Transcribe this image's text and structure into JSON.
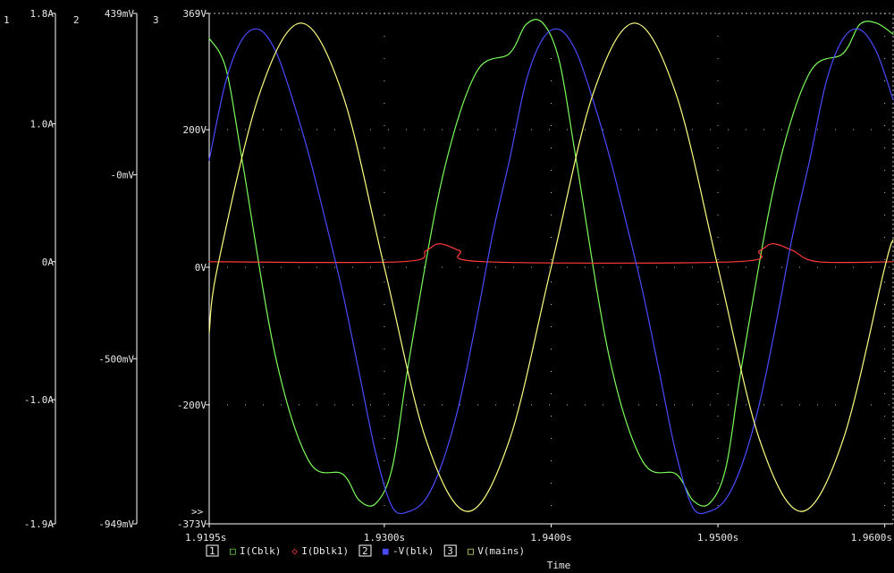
{
  "colors": {
    "background": "#000000",
    "axis": "#ffffff",
    "grid": "#bdbdbd",
    "text": "#e8e8e8",
    "green": "#7CFC5A",
    "red": "#ff3b3b",
    "blue": "#4a4aff",
    "yellow": "#ffff80"
  },
  "chart_data": {
    "type": "line",
    "xlabel": "Time",
    "x_range": [
      1.9195,
      1.9605
    ],
    "x_ticks": [
      {
        "value": 1.9195,
        "label": "1.9195s"
      },
      {
        "value": 1.93,
        "label": "1.9300s"
      },
      {
        "value": 1.94,
        "label": "1.9400s"
      },
      {
        "value": 1.95,
        "label": "1.9500s"
      },
      {
        "value": 1.96,
        "label": "1.9600s"
      }
    ],
    "axes": [
      {
        "id": "1",
        "label": "1",
        "range": [
          -1.9,
          1.8
        ],
        "ticks": [
          {
            "value": 1.8,
            "label": "1.8A"
          },
          {
            "value": 1.0,
            "label": "1.0A"
          },
          {
            "value": 0,
            "label": "0A"
          },
          {
            "value": -1.0,
            "label": "-1.0A"
          },
          {
            "value": -1.9,
            "label": "-1.9A"
          }
        ]
      },
      {
        "id": "2",
        "label": "2",
        "range": [
          -949,
          439
        ],
        "ticks": [
          {
            "value": 439,
            "label": "439mV"
          },
          {
            "value": 0,
            "label": "-0mV"
          },
          {
            "value": -500,
            "label": "-500mV"
          },
          {
            "value": -949,
            "label": "-949mV"
          }
        ]
      },
      {
        "id": "3",
        "label": "3",
        "range": [
          -373,
          369
        ],
        "ticks": [
          {
            "value": 369,
            "label": "369V"
          },
          {
            "value": 200,
            "label": "200V"
          },
          {
            "value": 0,
            "label": "0V"
          },
          {
            "value": -200,
            "label": "-200V"
          },
          {
            "value": -373,
            "label": "-373V"
          }
        ]
      }
    ],
    "overflow_marker": ">>",
    "series": [
      {
        "name": "I(Cblk)",
        "axis": "1",
        "axis_label": "1",
        "marker": "□",
        "color": "green",
        "x": [
          1.9195,
          1.9205,
          1.9215,
          1.9235,
          1.9255,
          1.9275,
          1.9285,
          1.9295,
          1.9305,
          1.9315,
          1.9335,
          1.9355,
          1.9375,
          1.9385,
          1.9395,
          1.9405,
          1.9415,
          1.9435,
          1.9455,
          1.9475,
          1.9485,
          1.9495,
          1.9505,
          1.9515,
          1.9535,
          1.9555,
          1.9575,
          1.9585,
          1.9595,
          1.9605
        ],
        "y": [
          1.62,
          1.4,
          0.72,
          -0.7,
          -1.45,
          -1.54,
          -1.73,
          -1.75,
          -1.48,
          -0.7,
          0.62,
          1.37,
          1.51,
          1.72,
          1.73,
          1.45,
          0.74,
          -0.7,
          -1.45,
          -1.54,
          -1.73,
          -1.75,
          -1.48,
          -0.7,
          0.62,
          1.37,
          1.51,
          1.72,
          1.73,
          1.65
        ]
      },
      {
        "name": "I(Dblk1)",
        "axis": "1",
        "axis_label": "1",
        "marker": "◇",
        "color": "red",
        "x": [
          1.9195,
          1.931,
          1.9325,
          1.9333,
          1.9345,
          1.936,
          1.951,
          1.9525,
          1.9533,
          1.9545,
          1.956,
          1.9605
        ],
        "y": [
          0,
          0,
          0.08,
          0.13,
          0.08,
          0,
          0,
          0.08,
          0.13,
          0.08,
          0,
          0
        ]
      },
      {
        "name": "-V(blk)",
        "axis": "2",
        "axis_label": "2",
        "marker": "■",
        "color": "blue",
        "x": [
          1.9195,
          1.9205,
          1.9215,
          1.9225,
          1.9235,
          1.9245,
          1.9255,
          1.9265,
          1.9275,
          1.9285,
          1.9295,
          1.9305,
          1.9315,
          1.9325,
          1.9335,
          1.9345,
          1.9355,
          1.9365,
          1.9375,
          1.9385,
          1.9395,
          1.9405,
          1.9415,
          1.9425,
          1.9435,
          1.9445,
          1.9455,
          1.9465,
          1.9475,
          1.9485,
          1.9495,
          1.9505,
          1.9515,
          1.9525,
          1.9535,
          1.9545,
          1.9555,
          1.9565,
          1.9575,
          1.9585,
          1.9595,
          1.9605
        ],
        "y": [
          40,
          255,
          370,
          395,
          335,
          205,
          50,
          -130,
          -320,
          -540,
          -760,
          -905,
          -915,
          -880,
          -780,
          -620,
          -400,
          -160,
          40,
          255,
          370,
          395,
          335,
          205,
          50,
          -130,
          -320,
          -540,
          -760,
          -905,
          -915,
          -880,
          -780,
          -620,
          -400,
          -160,
          40,
          255,
          370,
          395,
          335,
          205
        ]
      },
      {
        "name": "V(mains)",
        "axis": "3",
        "axis_label": "3",
        "marker": "□",
        "color": "yellow",
        "x": [
          1.9195,
          1.92,
          1.9225,
          1.925,
          1.9275,
          1.93,
          1.9325,
          1.935,
          1.9375,
          1.94,
          1.9425,
          1.945,
          1.9475,
          1.95,
          1.9525,
          1.955,
          1.9575,
          1.96,
          1.9605
        ],
        "y": [
          -95,
          0,
          251,
          355,
          251,
          0,
          -251,
          -355,
          -251,
          0,
          251,
          355,
          251,
          0,
          -251,
          -355,
          -251,
          0,
          40
        ]
      }
    ]
  }
}
